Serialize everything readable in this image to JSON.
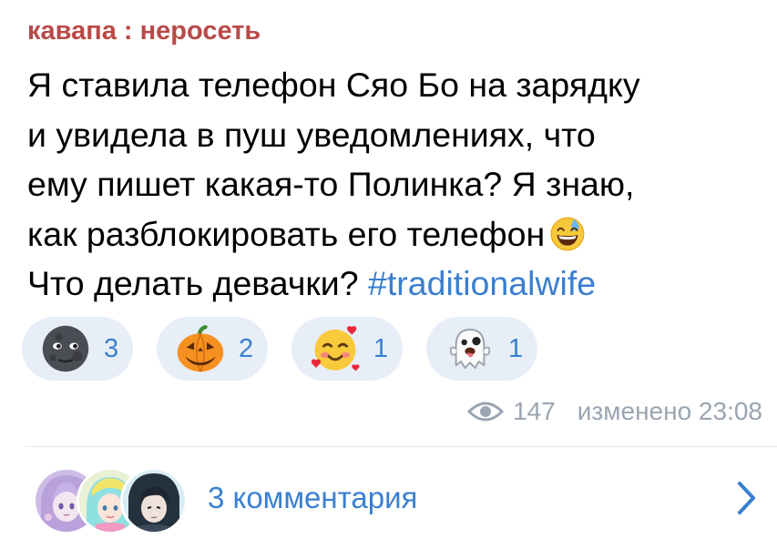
{
  "channel": {
    "name": "кавапа : неросеть"
  },
  "message": {
    "lines": [
      "Я ставила телефон Сяо Бо на зарядку",
      "и увидела в пуш уведомлениях, что",
      "ему пишет какая-то Полинка? Я знаю,",
      "как разблокировать его телефон"
    ],
    "line5_text": "Что делать девачки?",
    "hashtag": "#traditionalwife",
    "inline_emoji": "grinning-face-with-sweat-icon"
  },
  "reactions": [
    {
      "icon": "new-moon-face-icon",
      "count": "3"
    },
    {
      "icon": "jack-o-lantern-icon",
      "count": "2"
    },
    {
      "icon": "smiling-face-with-hearts-icon",
      "count": "1"
    },
    {
      "icon": "ghost-icon",
      "count": "1"
    }
  ],
  "meta": {
    "views": "147",
    "edited": "изменено 23:08",
    "eye_icon": "eye-icon"
  },
  "comments": {
    "label": "3 комментария",
    "avatar_count": 3,
    "chevron_icon": "chevron-right-icon"
  },
  "colors": {
    "channel_name": "#b94a48",
    "accent": "#3a7fd0",
    "reaction_bg": "#e8eef8",
    "meta_text": "#9aa5b1"
  }
}
